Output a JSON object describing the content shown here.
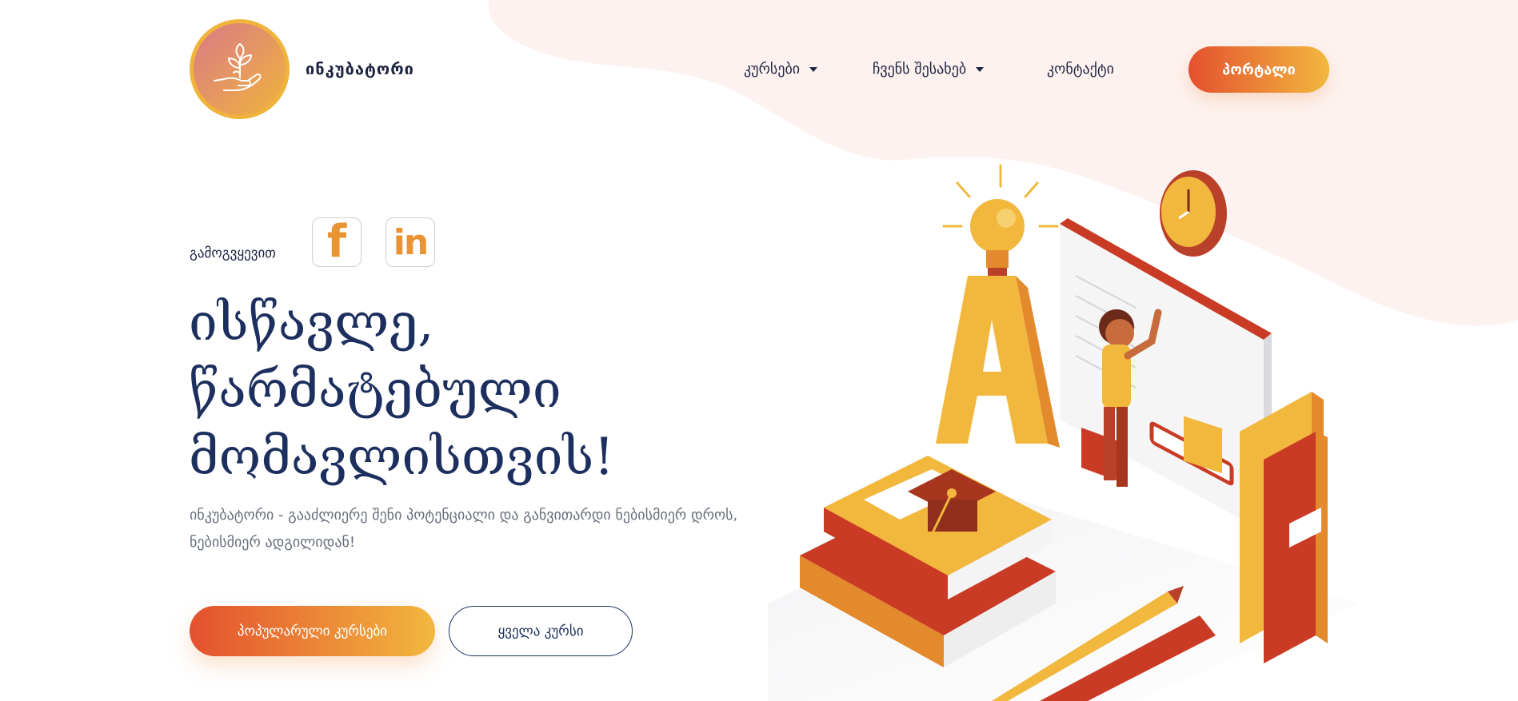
{
  "brand": {
    "name": "ინკუბატორი"
  },
  "nav": {
    "courses": "კურსები",
    "about": "ჩვენს შესახებ",
    "contact": "კონტაქტი",
    "portal": "პორტალი"
  },
  "social": {
    "follow_label": "გამოგვყევით",
    "facebook_glyph": "f",
    "linkedin_glyph": "in"
  },
  "hero": {
    "headline_line1": "ისწავლე,",
    "headline_line2": "წარმატებული",
    "headline_line3": "მომავლისთვის!",
    "description": "ინკუბატორი - გააძლიერე შენი პოტენციალი და განვითარდი ნებისმიერ დროს, ნებისმიერ ადგილიდან!"
  },
  "buttons": {
    "popular_courses": "პოპულარული კურსები",
    "all_courses": "ყველა კურსი"
  },
  "colors": {
    "navy": "#1c2f5e",
    "accent_orange": "#e4502f",
    "accent_yellow": "#f2b83e",
    "blob_pink": "#fdf2f0"
  },
  "icons": [
    "plant-hand-icon",
    "facebook-icon",
    "linkedin-icon",
    "caret-down-icon"
  ]
}
